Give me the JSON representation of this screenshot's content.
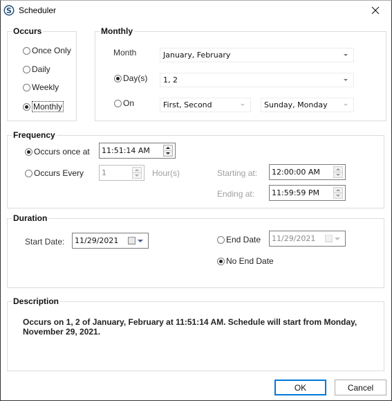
{
  "window": {
    "title": "Scheduler",
    "app_icon": "scheduler-s-logo-icon",
    "close_icon": "close-icon"
  },
  "occurs": {
    "title": "Occurs",
    "options": [
      {
        "label": "Once Only",
        "checked": false
      },
      {
        "label": "Daily",
        "checked": false
      },
      {
        "label": "Weekly",
        "checked": false
      },
      {
        "label": "Monthly",
        "checked": true
      }
    ]
  },
  "monthly": {
    "title": "Monthly",
    "month_label": "Month",
    "month_value": "January, February",
    "days_label": "Day(s)",
    "days_checked": true,
    "days_value": "1, 2",
    "on_label": "On",
    "on_checked": false,
    "on_ordinal_value": "First, Second",
    "on_weekday_value": "Sunday, Monday"
  },
  "frequency": {
    "title": "Frequency",
    "once_label": "Occurs once at",
    "once_checked": true,
    "once_time": "11:51:14 AM",
    "every_label": "Occurs Every",
    "every_checked": false,
    "every_value": "1",
    "every_unit": "Hour(s)",
    "starting_label": "Starting at:",
    "starting_value": "12:00:00 AM",
    "ending_label": "Ending at:",
    "ending_value": "11:59:59 PM"
  },
  "duration": {
    "title": "Duration",
    "start_label": "Start Date:",
    "start_value": "11/29/2021",
    "end_date_label": "End Date",
    "end_date_checked": false,
    "end_date_value": "11/29/2021",
    "no_end_label": "No End Date",
    "no_end_checked": true
  },
  "description": {
    "title": "Description",
    "text": "Occurs on 1, 2 of January, February at 11:51:14 AM. Schedule will start from Monday, November 29, 2021."
  },
  "buttons": {
    "ok": "OK",
    "cancel": "Cancel"
  },
  "colors": {
    "accent": "#0078d7",
    "group_border": "#dcdcdc",
    "disabled_text": "#a0a0a0"
  }
}
